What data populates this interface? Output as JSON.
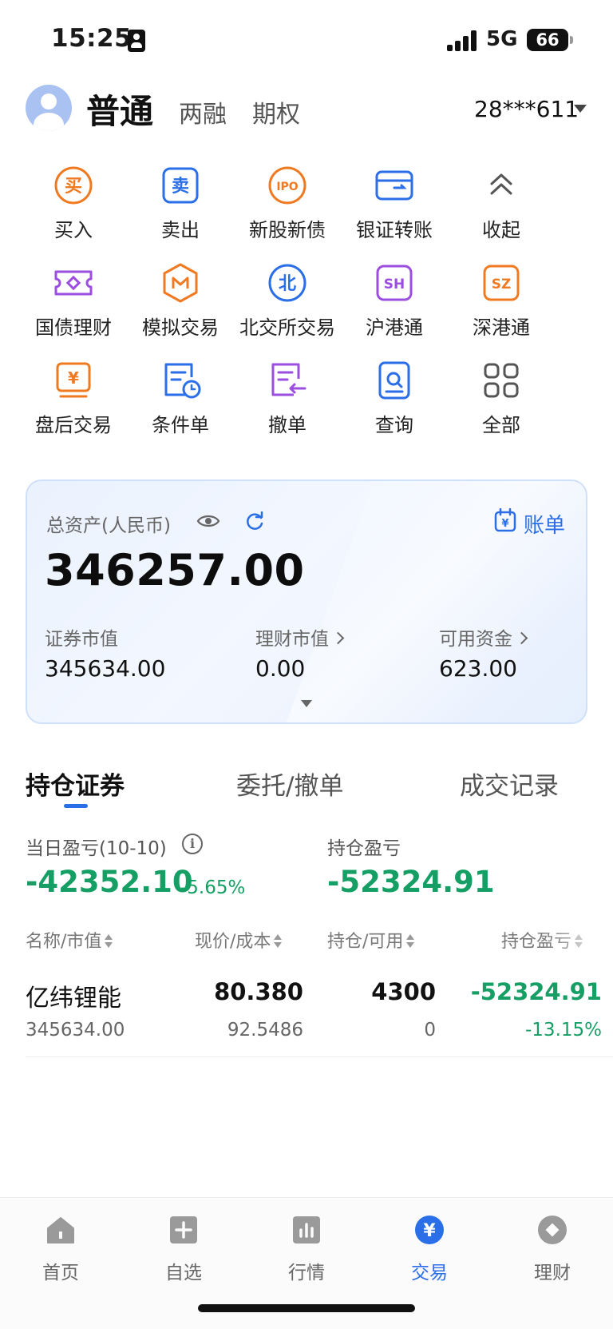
{
  "status_bar": {
    "time": "15:25",
    "network": "5G",
    "battery": "66"
  },
  "header": {
    "account_tabs": [
      "普通",
      "两融",
      "期权"
    ],
    "account_number": "28***611"
  },
  "functions": [
    {
      "label": "买入",
      "icon": "buy-icon",
      "color": "#f07a22"
    },
    {
      "label": "卖出",
      "icon": "sell-icon",
      "color": "#2a6ee8"
    },
    {
      "label": "新股新债",
      "icon": "ipo-icon",
      "color": "#f07a22",
      "glyph": "IPO"
    },
    {
      "label": "银证转账",
      "icon": "bank-transfer-icon",
      "color": "#2a6ee8"
    },
    {
      "label": "收起",
      "icon": "collapse-icon",
      "color": "#555555"
    },
    {
      "label": "国债理财",
      "icon": "bond-icon",
      "color": "#9b4ee0"
    },
    {
      "label": "模拟交易",
      "icon": "simulated-trade-icon",
      "color": "#f07a22"
    },
    {
      "label": "北交所交易",
      "icon": "bse-icon",
      "color": "#2a6ee8",
      "glyph": "北"
    },
    {
      "label": "沪港通",
      "icon": "sh-hk-connect-icon",
      "color": "#9b4ee0",
      "glyph": "SH"
    },
    {
      "label": "深港通",
      "icon": "sz-hk-connect-icon",
      "color": "#f07a22",
      "glyph": "SZ"
    },
    {
      "label": "盘后交易",
      "icon": "after-hours-icon",
      "color": "#f07a22",
      "glyph": "¥"
    },
    {
      "label": "条件单",
      "icon": "conditional-order-icon",
      "color": "#2a6ee8"
    },
    {
      "label": "撤单",
      "icon": "cancel-order-icon",
      "color": "#9b4ee0"
    },
    {
      "label": "查询",
      "icon": "query-icon",
      "color": "#2a6ee8"
    },
    {
      "label": "全部",
      "icon": "all-icon",
      "color": "#555555"
    }
  ],
  "assets": {
    "title": "总资产(人民币)",
    "bill_label": "账单",
    "total": "346257.00",
    "securities_label": "证券市值",
    "securities_value": "345634.00",
    "wealth_label": "理财市值",
    "wealth_value": "0.00",
    "cash_label": "可用资金",
    "cash_value": "623.00"
  },
  "tabs": [
    "持仓证券",
    "委托/撤单",
    "成交记录"
  ],
  "pnl": {
    "daily_label": "当日盈亏(10-10)",
    "daily_value": "-42352.10",
    "daily_pct": "-5.65%",
    "position_label": "持仓盈亏",
    "position_value": "-52324.91"
  },
  "table": {
    "headers": [
      "名称/市值",
      "现价/成本",
      "持仓/可用",
      "持仓盈亏"
    ],
    "rows": [
      {
        "name": "亿纬锂能",
        "market_value": "345634.00",
        "price": "80.380",
        "cost": "92.5486",
        "position": "4300",
        "available": "0",
        "pnl": "-52324.91",
        "pnl_pct": "-13.15%"
      }
    ]
  },
  "nav": [
    {
      "label": "首页",
      "icon": "home-icon"
    },
    {
      "label": "自选",
      "icon": "watchlist-icon"
    },
    {
      "label": "行情",
      "icon": "market-icon"
    },
    {
      "label": "交易",
      "icon": "trade-icon",
      "active": true
    },
    {
      "label": "理财",
      "icon": "wealth-icon"
    }
  ],
  "colors": {
    "accent": "#2a6ee8",
    "loss": "#159f64",
    "orange": "#f07a22",
    "purple": "#9b4ee0"
  }
}
